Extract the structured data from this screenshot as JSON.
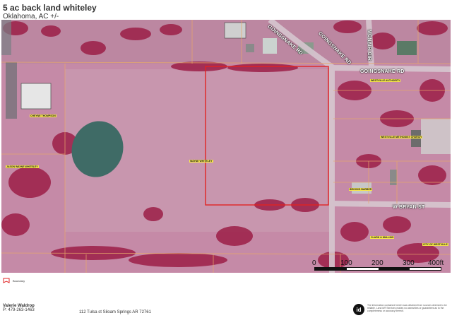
{
  "header": {
    "title": "5 ac back land whiteley",
    "subtitle": "Oklahoma,  AC +/-"
  },
  "map": {
    "roads": {
      "goingsnake_rd_ne": "GOINGSNAKE RD",
      "goingsnake_rd_e": "GOINGSNAKE RD",
      "mcnair_cir": "MCNAIR CIR",
      "w_bryan_st": "W BRYAN ST",
      "top_rd_label": "GOINGSNAKE RD"
    },
    "parcel_labels": [
      "CHEYNE THOMPSON",
      "JASON WAYNE WHITELEY",
      "WAYNE WHITELEY",
      "WESTVILLE AUTHORITY",
      "WESTVILLE METHODIST CHURCH",
      "BROOKS BARBER",
      "CLARK & MULLINS",
      "CITY OF WESTVILLE"
    ],
    "colors": {
      "field": "#c17a9e",
      "trees": "#9c1f47",
      "boundary": "#e02424",
      "parcel_lines": "#e8a86a"
    }
  },
  "scale": {
    "labels": [
      "0",
      "100",
      "200",
      "300",
      "400ft"
    ]
  },
  "legend": {
    "boundary_label": "Boundary",
    "boundary_color": "#e02424"
  },
  "footer": {
    "agent_name": "Valerie Waldrop",
    "agent_phone": "P: 479-263-1463",
    "address": "112 Tulsa st  Siloam Springs AR 72761",
    "logo_text": "id",
    "disclaimer": "The information contained herein was obtained from sources deemed to be reliable. Land id® Services makes no warranties or guarantees as to the completeness or accuracy thereof."
  }
}
